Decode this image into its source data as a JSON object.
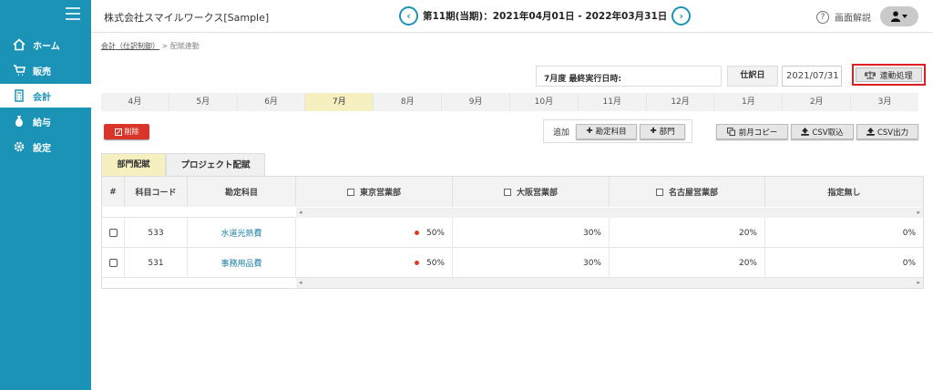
{
  "sidebar": {
    "items": [
      {
        "label": "ホーム",
        "icon": "home-icon"
      },
      {
        "label": "販売",
        "icon": "cart-icon"
      },
      {
        "label": "会計",
        "icon": "calculator-icon",
        "active": true
      },
      {
        "label": "給与",
        "icon": "money-bag-icon"
      },
      {
        "label": "設定",
        "icon": "gear-icon"
      }
    ]
  },
  "header": {
    "company": "株式会社スマイルワークス[Sample]",
    "period": "第11期(当期)：2021年04月01日 - 2022年03月31日",
    "prev_icon": "‹",
    "next_icon": "›",
    "help_label": "画面解説",
    "help_icon": "?"
  },
  "breadcrumb": {
    "parent": "会計（仕訳制御）",
    "separator": ">",
    "current": "配賦連動"
  },
  "controls": {
    "last_run_label": "7月度 最終実行日時:",
    "slip_date_label": "仕訳日",
    "slip_date_value": "2021/07/31",
    "link_button": "連動処理"
  },
  "months": [
    "4月",
    "5月",
    "6月",
    "7月",
    "8月",
    "9月",
    "10月",
    "11月",
    "12月",
    "1月",
    "2月",
    "3月"
  ],
  "active_month": "7月",
  "actions": {
    "delete": "削除",
    "add_label": "追加",
    "add_account": "勘定科目",
    "add_dept": "部門",
    "copy_prev": "前月コピー",
    "csv_import": "CSV取込",
    "csv_export": "CSV出力"
  },
  "tabs": [
    "部門配賦",
    "プロジェクト配賦"
  ],
  "table": {
    "headers": {
      "hash": "#",
      "code": "科目コード",
      "account": "勘定科目",
      "tokyo": "東京営業部",
      "osaka": "大阪営業部",
      "nagoya": "名古屋営業部",
      "none": "指定無し"
    },
    "rows": [
      {
        "code": "533",
        "account": "水道光熱費",
        "tokyo": "50%",
        "osaka": "30%",
        "nagoya": "20%",
        "none": "0%"
      },
      {
        "code": "531",
        "account": "事務用品費",
        "tokyo": "50%",
        "osaka": "30%",
        "nagoya": "20%",
        "none": "0%"
      }
    ]
  },
  "colors": {
    "sidebar": "#1a93b7",
    "active_month": "#f6f0c0",
    "delete": "#d9352b",
    "highlight": "#e02020"
  }
}
